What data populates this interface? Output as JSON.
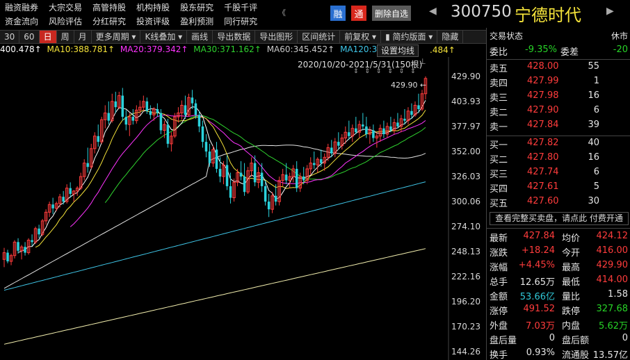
{
  "topmenu": {
    "row1": [
      "融资融券",
      "大宗交易",
      "高管持股",
      "机构持股",
      "股东研究",
      "千股千评"
    ],
    "row2": [
      "资金流向",
      "风险评估",
      "分红研究",
      "投资评级",
      "盈利预测",
      "同行研究"
    ],
    "more": "《"
  },
  "header": {
    "badge_rong": "融",
    "badge_tong": "通",
    "remove_btn": "删除自选",
    "prev": "◀",
    "next": "▶",
    "code": "300750",
    "name": "宁德时代"
  },
  "toolbar": [
    "30",
    "60",
    "日",
    "周",
    "月",
    "更多周期 ▾",
    "K线叠加 ▾",
    "画线",
    "导出数据",
    "导出图形",
    "区间统计",
    "前复权 ▾",
    "▮ 简约版面 ▾",
    "隐藏"
  ],
  "toolbar_active": "日",
  "ma_bar": {
    "ma5": "400.478↑",
    "ma10": "MA10:388.781↑",
    "ma20": "MA20:379.342↑",
    "ma30": "MA30:371.162↑",
    "ma60": "MA60:345.452↑",
    "ma120": "MA120:345.481",
    "set_btn": "设置均线",
    "extra": ".484↑"
  },
  "range_label": "2020/10/20-2021/5/31(150根)",
  "pin_icon": "📌",
  "dots": "⇕ ⇕ ⇕ ⇕ ⇕ ⇕",
  "high_marker": "429.90 ←",
  "y_axis": [
    "429.90",
    "403.93",
    "377.97",
    "352.00",
    "326.03",
    "300.06",
    "274.10",
    "248.13",
    "222.16",
    "196.20",
    "170.23",
    "144.26"
  ],
  "colors": {
    "up": "#ff3c3c",
    "down": "#2bd2dc",
    "ma5": "#ffffff",
    "ma10": "#f5e33a",
    "ma20": "#ff34ff",
    "ma30": "#2fd32f",
    "ma60": "#e4e4e4",
    "ma120": "#3fc6e8",
    "ma250": "#f2eeae"
  },
  "chart_data": {
    "type": "candlestick",
    "period": "2020/10/20-2021/5/31",
    "bars_count": 150,
    "y_axis_ticks": [
      429.9,
      403.93,
      377.97,
      352.0,
      326.03,
      300.06,
      274.1,
      248.13,
      222.16,
      196.2,
      170.23,
      144.26
    ],
    "high": 429.9,
    "ma_values": {
      "MA5": 400.478,
      "MA10": 388.781,
      "MA20": 379.342,
      "MA30": 371.162,
      "MA60": 345.452,
      "MA120": 345.481
    },
    "candles": [
      [
        240,
        252,
        232,
        247
      ],
      [
        247,
        250,
        236,
        238
      ],
      [
        238,
        246,
        234,
        244
      ],
      [
        244,
        260,
        241,
        258
      ],
      [
        258,
        262,
        246,
        249
      ],
      [
        249,
        255,
        240,
        253
      ],
      [
        253,
        258,
        244,
        247
      ],
      [
        247,
        262,
        245,
        260
      ],
      [
        260,
        266,
        254,
        258
      ],
      [
        258,
        274,
        256,
        272
      ],
      [
        272,
        276,
        262,
        266
      ],
      [
        266,
        282,
        264,
        280
      ],
      [
        280,
        292,
        276,
        289
      ],
      [
        289,
        300,
        284,
        297
      ],
      [
        297,
        304,
        287,
        293
      ],
      [
        293,
        300,
        290,
        298
      ],
      [
        298,
        308,
        294,
        305
      ],
      [
        305,
        311,
        297,
        300
      ],
      [
        300,
        318,
        298,
        314
      ],
      [
        314,
        320,
        304,
        308
      ],
      [
        308,
        312,
        300,
        311
      ],
      [
        311,
        316,
        306,
        314
      ],
      [
        314,
        330,
        312,
        326
      ],
      [
        326,
        344,
        322,
        340
      ],
      [
        340,
        356,
        330,
        336
      ],
      [
        336,
        360,
        334,
        355
      ],
      [
        355,
        372,
        350,
        368
      ],
      [
        368,
        380,
        357,
        362
      ],
      [
        362,
        388,
        360,
        385
      ],
      [
        385,
        400,
        376,
        392
      ],
      [
        392,
        404,
        380,
        384
      ],
      [
        384,
        412,
        382,
        404
      ],
      [
        404,
        414,
        392,
        398
      ],
      [
        398,
        414,
        396,
        410
      ],
      [
        410,
        418,
        384,
        388
      ],
      [
        388,
        395,
        374,
        380
      ],
      [
        380,
        392,
        368,
        388
      ],
      [
        388,
        396,
        380,
        384
      ],
      [
        384,
        400,
        381,
        395
      ],
      [
        395,
        405,
        390,
        398
      ],
      [
        398,
        410,
        394,
        404
      ],
      [
        404,
        408,
        391,
        394
      ],
      [
        394,
        400,
        386,
        390
      ],
      [
        390,
        398,
        384,
        396
      ],
      [
        396,
        402,
        388,
        392
      ],
      [
        392,
        396,
        370,
        374
      ],
      [
        374,
        384,
        366,
        380
      ],
      [
        380,
        386,
        356,
        360
      ],
      [
        360,
        372,
        352,
        368
      ],
      [
        368,
        392,
        366,
        388
      ],
      [
        388,
        398,
        382,
        392
      ],
      [
        392,
        405,
        385,
        400
      ],
      [
        400,
        410,
        386,
        390
      ],
      [
        390,
        412,
        388,
        408
      ],
      [
        408,
        416,
        396,
        402
      ],
      [
        402,
        406,
        386,
        390
      ],
      [
        390,
        394,
        372,
        378
      ],
      [
        378,
        384,
        356,
        362
      ],
      [
        362,
        370,
        346,
        352
      ],
      [
        352,
        360,
        336,
        340
      ],
      [
        340,
        358,
        336,
        354
      ],
      [
        354,
        362,
        330,
        334
      ],
      [
        334,
        346,
        320,
        326
      ],
      [
        326,
        342,
        318,
        338
      ],
      [
        338,
        348,
        312,
        316
      ],
      [
        316,
        330,
        298,
        304
      ],
      [
        304,
        324,
        300,
        320
      ],
      [
        320,
        334,
        316,
        330
      ],
      [
        330,
        342,
        322,
        326
      ],
      [
        326,
        340,
        306,
        310
      ],
      [
        310,
        336,
        308,
        332
      ],
      [
        332,
        346,
        326,
        340
      ],
      [
        340,
        348,
        316,
        320
      ],
      [
        320,
        336,
        314,
        330
      ],
      [
        330,
        340,
        310,
        316
      ],
      [
        316,
        322,
        296,
        300
      ],
      [
        300,
        308,
        284,
        292
      ],
      [
        292,
        310,
        288,
        306
      ],
      [
        306,
        318,
        296,
        300
      ],
      [
        300,
        326,
        296,
        322
      ],
      [
        322,
        334,
        316,
        328
      ],
      [
        328,
        340,
        318,
        322
      ],
      [
        322,
        330,
        314,
        326
      ],
      [
        326,
        338,
        320,
        334
      ],
      [
        334,
        342,
        310,
        314
      ],
      [
        314,
        330,
        310,
        326
      ],
      [
        326,
        336,
        318,
        322
      ],
      [
        322,
        338,
        318,
        334
      ],
      [
        334,
        346,
        328,
        340
      ],
      [
        340,
        352,
        334,
        338
      ],
      [
        338,
        346,
        330,
        344
      ],
      [
        344,
        354,
        336,
        340
      ],
      [
        340,
        350,
        332,
        346
      ],
      [
        346,
        360,
        342,
        356
      ],
      [
        356,
        364,
        346,
        350
      ],
      [
        350,
        366,
        346,
        362
      ],
      [
        362,
        372,
        354,
        358
      ],
      [
        358,
        370,
        354,
        366
      ],
      [
        366,
        378,
        360,
        372
      ],
      [
        372,
        384,
        364,
        368
      ],
      [
        368,
        380,
        362,
        376
      ],
      [
        376,
        388,
        370,
        372
      ],
      [
        372,
        384,
        366,
        380
      ],
      [
        380,
        392,
        374,
        378
      ],
      [
        378,
        388,
        366,
        370
      ],
      [
        370,
        378,
        360,
        374
      ],
      [
        374,
        380,
        362,
        366
      ],
      [
        366,
        372,
        356,
        368
      ],
      [
        368,
        380,
        362,
        376
      ],
      [
        376,
        384,
        366,
        370
      ],
      [
        370,
        382,
        366,
        378
      ],
      [
        378,
        388,
        372,
        374
      ],
      [
        374,
        386,
        370,
        382
      ],
      [
        382,
        392,
        376,
        378
      ],
      [
        378,
        390,
        372,
        386
      ],
      [
        386,
        396,
        380,
        384
      ],
      [
        384,
        398,
        380,
        394
      ],
      [
        394,
        402,
        386,
        390
      ],
      [
        390,
        404,
        388,
        400
      ],
      [
        400,
        412,
        392,
        396
      ],
      [
        396,
        416,
        394,
        412
      ],
      [
        412,
        430,
        406,
        427.84
      ]
    ]
  },
  "rpanel": {
    "head_left": "交易状态",
    "head_right": "休市",
    "weibi_label": "委比",
    "weibi_value": "-9.35%",
    "weicha_label": "委差",
    "weicha_value": "-20",
    "sells": [
      {
        "label": "卖五",
        "price": "428.00",
        "vol": "55"
      },
      {
        "label": "卖四",
        "price": "427.99",
        "vol": "1"
      },
      {
        "label": "卖三",
        "price": "427.98",
        "vol": "16"
      },
      {
        "label": "卖二",
        "price": "427.90",
        "vol": "6"
      },
      {
        "label": "卖一",
        "price": "427.84",
        "vol": "39"
      }
    ],
    "buys": [
      {
        "label": "买一",
        "price": "427.82",
        "vol": "40"
      },
      {
        "label": "买二",
        "price": "427.80",
        "vol": "16"
      },
      {
        "label": "买三",
        "price": "427.74",
        "vol": "6"
      },
      {
        "label": "买四",
        "price": "427.61",
        "vol": "5"
      },
      {
        "label": "买五",
        "price": "427.60",
        "vol": "30"
      }
    ],
    "full_btn": "查看完整买卖盘，请点此 付费开通",
    "stats": [
      {
        "l1": "最新",
        "v1": "427.84",
        "c1": "red",
        "l2": "均价",
        "v2": "424.12",
        "c2": "red"
      },
      {
        "l1": "涨跌",
        "v1": "+18.24",
        "c1": "red",
        "l2": "今开",
        "v2": "416.00",
        "c2": "red"
      },
      {
        "l1": "涨幅",
        "v1": "+4.45%",
        "c1": "red",
        "l2": "最高",
        "v2": "429.90",
        "c2": "red"
      },
      {
        "l1": "总手",
        "v1": "12.65万",
        "c1": "white",
        "l2": "最低",
        "v2": "414.00",
        "c2": "red"
      },
      {
        "l1": "金额",
        "v1": "53.66亿",
        "c1": "cyan",
        "l2": "量比",
        "v2": "1.58",
        "c2": "white"
      },
      {
        "l1": "涨停",
        "v1": "491.52",
        "c1": "red",
        "l2": "跌停",
        "v2": "327.68",
        "c2": "green"
      },
      {
        "l1": "外盘",
        "v1": "7.03万",
        "c1": "red",
        "l2": "内盘",
        "v2": "5.62万",
        "c2": "green"
      },
      {
        "l1": "盘后量",
        "v1": "0",
        "c1": "white",
        "l2": "盘后额",
        "v2": "0",
        "c2": "white"
      },
      {
        "l1": "换手",
        "v1": "0.93%",
        "c1": "white",
        "l2": "流通股",
        "v2": "13.57亿",
        "c2": "white"
      }
    ]
  }
}
